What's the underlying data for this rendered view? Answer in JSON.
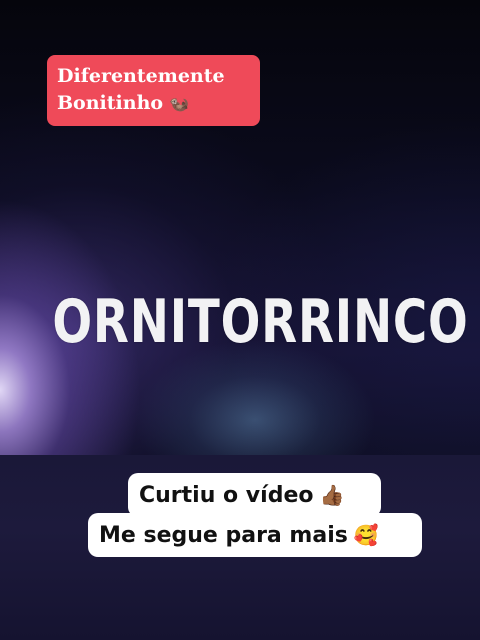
{
  "top_badge": {
    "line1": "Diferentemente",
    "line2": "Bonitinho",
    "emoji": "🦦"
  },
  "main": {
    "title": "ORNITORRINCO"
  },
  "captions": {
    "line1": "Curtiu o vídeo",
    "line1_emoji": "👍🏾",
    "line2": "Me segue para mais",
    "line2_emoji": "🥰"
  },
  "colors": {
    "badge_background": "#ef4a59",
    "caption_background": "#ffffff",
    "title_color": "#f2f2f4"
  }
}
